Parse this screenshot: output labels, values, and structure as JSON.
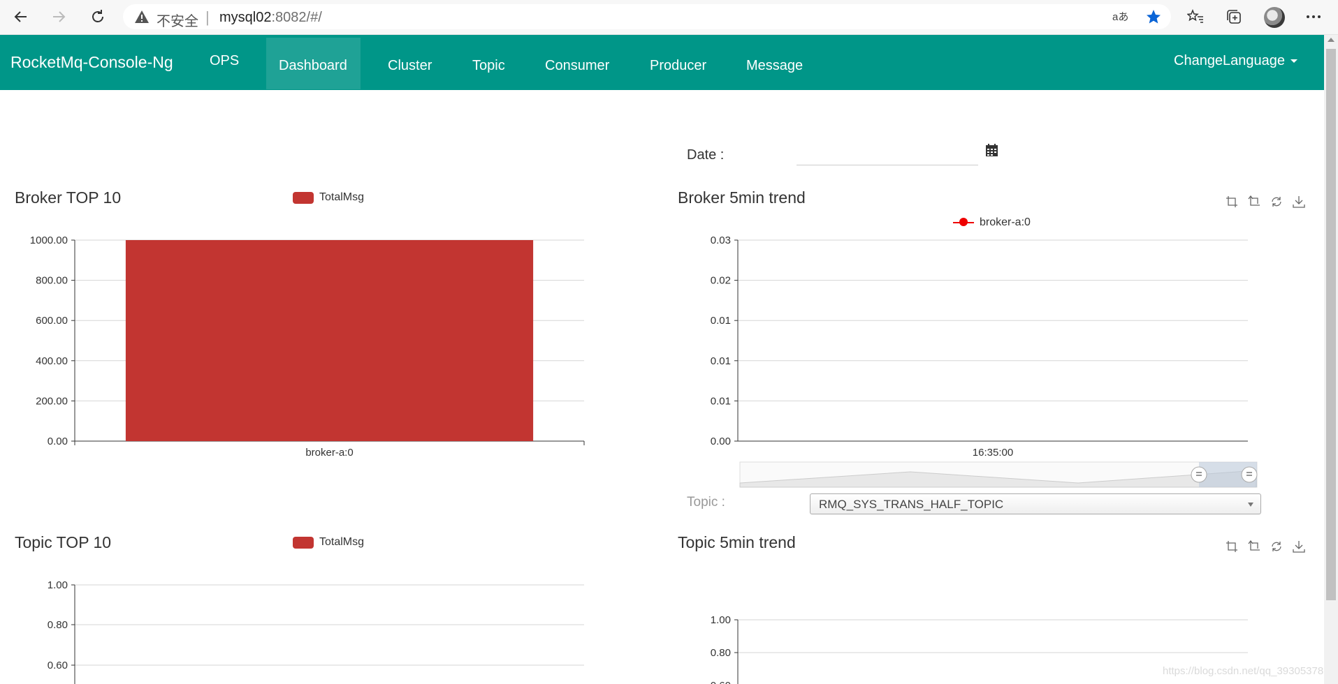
{
  "browser": {
    "insecure_label": "不安全",
    "separator": "|",
    "url_host": "mysql02",
    "url_rest": ":8082/#/"
  },
  "navbar": {
    "brand": "RocketMq-Console-Ng",
    "items": [
      {
        "label": "OPS",
        "active": false
      },
      {
        "label": "Dashboard",
        "active": true
      },
      {
        "label": "Cluster",
        "active": false
      },
      {
        "label": "Topic",
        "active": false
      },
      {
        "label": "Consumer",
        "active": false
      },
      {
        "label": "Producer",
        "active": false
      },
      {
        "label": "Message",
        "active": false
      }
    ],
    "language": "ChangeLanguage"
  },
  "date": {
    "label": "Date :",
    "value": ""
  },
  "broker_top": {
    "title": "Broker TOP 10",
    "legend": "TotalMsg"
  },
  "broker_trend": {
    "title": "Broker 5min trend",
    "legend": "broker-a:0"
  },
  "topic_select": {
    "label": "Topic :",
    "value": "RMQ_SYS_TRANS_HALF_TOPIC"
  },
  "topic_top": {
    "title": "Topic TOP 10",
    "legend": "TotalMsg"
  },
  "topic_trend": {
    "title": "Topic 5min trend"
  },
  "watermark": "https://blog.csdn.net/qq_39305378",
  "colors": {
    "navbar": "#009688",
    "bar": "#c23531",
    "trend_line": "#ff0000"
  },
  "chart_data": [
    {
      "type": "bar",
      "title": "Broker TOP 10",
      "categories": [
        "broker-a:0"
      ],
      "series": [
        {
          "name": "TotalMsg",
          "values": [
            1000
          ]
        }
      ],
      "ylim": [
        0,
        1000
      ],
      "yticks": [
        "0.00",
        "200.00",
        "400.00",
        "600.00",
        "800.00",
        "1000.00"
      ],
      "grid": true,
      "legend": "top"
    },
    {
      "type": "line",
      "title": "Broker 5min trend",
      "x": [
        "16:35:00"
      ],
      "series": [
        {
          "name": "broker-a:0",
          "values": [
            0
          ]
        }
      ],
      "yticks": [
        "0.00",
        "0.01",
        "0.01",
        "0.01",
        "0.02",
        "0.03"
      ],
      "grid": true,
      "legend": "top"
    },
    {
      "type": "bar",
      "title": "Topic TOP 10",
      "categories": [],
      "series": [
        {
          "name": "TotalMsg",
          "values": []
        }
      ],
      "yticks_visible": [
        "1.00",
        "0.80",
        "0.60"
      ],
      "grid": true,
      "legend": "top"
    },
    {
      "type": "line",
      "title": "Topic 5min trend",
      "x": [],
      "series": [],
      "yticks_visible": [
        "1.00",
        "0.80",
        "0.60"
      ],
      "grid": true
    }
  ]
}
